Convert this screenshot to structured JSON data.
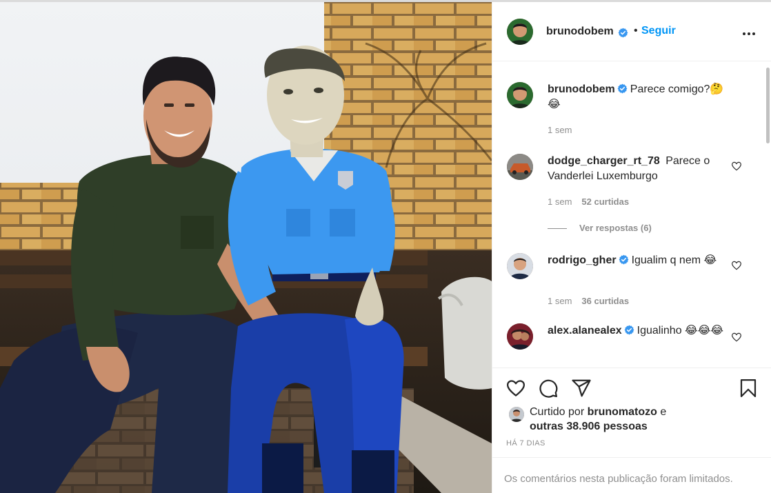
{
  "post": {
    "author": "brunodobem",
    "follow_label": "Seguir",
    "separator": "•",
    "more_icon": "more-options-icon",
    "verified_color": "#3897f0",
    "link_color": "#0095f6"
  },
  "caption": {
    "username": "brunodobem",
    "text": "Parece comigo?🤔😂",
    "time": "1 sem"
  },
  "comments": [
    {
      "username": "dodge_charger_rt_78",
      "text": "Parece o Vanderlei Luxemburgo",
      "time": "1 sem",
      "likes": "52 curtidas",
      "replies": "Ver respostas (6)"
    },
    {
      "username": "rodrigo_gher",
      "verified": true,
      "text": "Igualim q nem 😂",
      "time": "1 sem",
      "likes": "36 curtidas"
    },
    {
      "username": "alex.alanealex",
      "verified": true,
      "text": "Igualinho 😂😂😂"
    }
  ],
  "actions": [
    "heart-icon",
    "comment-icon",
    "share-icon",
    "bookmark-icon"
  ],
  "liked_by": {
    "prefix": "Curtido por",
    "user": "brunomatozo",
    "conjunction": "e",
    "others": "outras 38.906 pessoas"
  },
  "timestamp": "HÁ 7 DIAS",
  "comments_limited": "Os comentários nesta publicação foram limitados."
}
